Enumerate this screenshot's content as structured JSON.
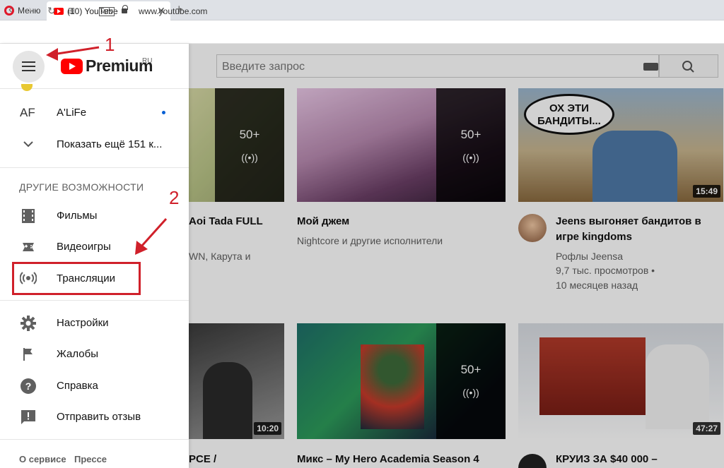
{
  "browser": {
    "menu_label": "Меню",
    "tab_title": "(10) YouTube",
    "tab_close": "✕",
    "new_tab": "+",
    "vpn_badge": "VPN",
    "url": "www.youtube.com"
  },
  "header": {
    "logo_text": "Premium",
    "logo_region": "RU",
    "search_placeholder": "Введите запрос"
  },
  "sidebar": {
    "subscriptions": [
      {
        "avatar": "AF",
        "label": "A'LiFe"
      },
      {
        "label": "Показать ещё 151 к..."
      }
    ],
    "section_title": "ДРУГИЕ ВОЗМОЖНОСТИ",
    "other": [
      {
        "label": "Фильмы",
        "icon": "film-icon"
      },
      {
        "label": "Видеоигры",
        "icon": "gamepad-icon"
      },
      {
        "label": "Трансляции",
        "icon": "live-icon"
      }
    ],
    "settings": [
      {
        "label": "Настройки",
        "icon": "gear-icon"
      },
      {
        "label": "Жалобы",
        "icon": "flag-icon"
      },
      {
        "label": "Справка",
        "icon": "help-icon"
      },
      {
        "label": "Отправить отзыв",
        "icon": "feedback-icon"
      }
    ],
    "footer": [
      "О сервисе",
      "Прессе"
    ]
  },
  "annotations": {
    "step1": "1",
    "step2": "2",
    "color": "#d0202a"
  },
  "videos": [
    {
      "title": "Aoi Tada FULL",
      "channel": "WN, Карута и",
      "playlist_count": "50+"
    },
    {
      "title": "Мой джем",
      "channel": "Nightcore и другие исполнители",
      "playlist_count": "50+"
    },
    {
      "title_line1": "Jeens выгоняет бандитов в",
      "title_line2": "игре kingdoms",
      "channel": "Рофлы Jeensa",
      "views": "9,7 тыс. просмотров •",
      "age": "10 месяцев назад",
      "duration": "15:49",
      "thumb_caption": "ОХ ЭТИ БАНДИТЫ..."
    },
    {
      "title": "PCE /",
      "duration": "10:20"
    },
    {
      "title": "Микс – My Hero Academia Season 4",
      "playlist_count": "50+"
    },
    {
      "title": "КРУИЗ ЗА $40 000 –",
      "duration": "47:27"
    }
  ]
}
